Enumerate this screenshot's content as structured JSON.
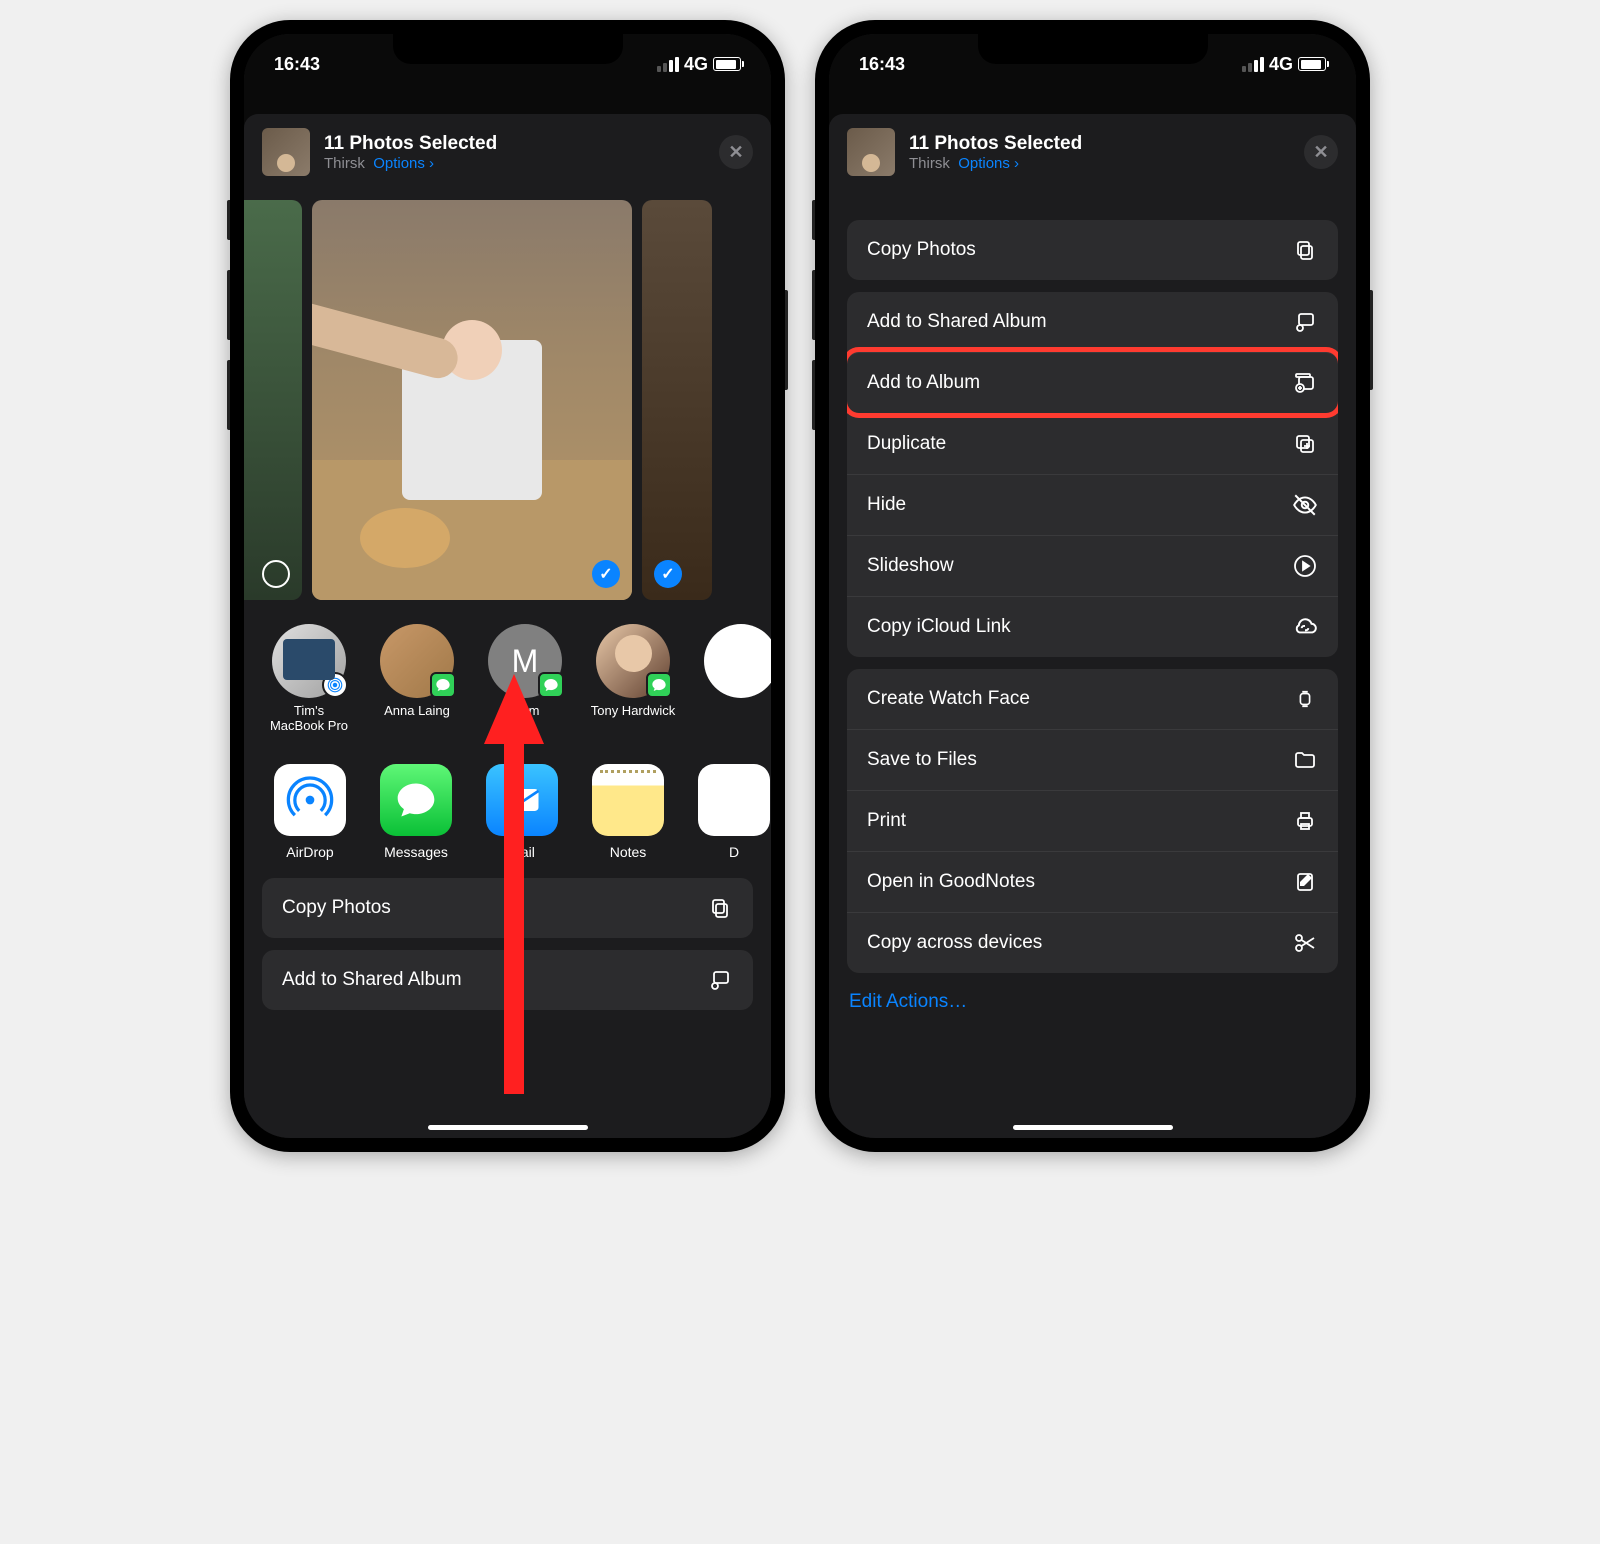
{
  "status": {
    "time": "16:43",
    "network_label": "4G"
  },
  "header": {
    "title": "11 Photos Selected",
    "location": "Thirsk",
    "options_label": "Options"
  },
  "contacts": [
    {
      "name": "Tim's MacBook Pro",
      "badge": "airdrop",
      "avatar": "mac"
    },
    {
      "name": "Anna Laing",
      "badge": "msg",
      "avatar": "person1"
    },
    {
      "name": "Mum",
      "badge": "msg",
      "avatar": "person2",
      "initial": "M"
    },
    {
      "name": "Tony Hardwick",
      "badge": "msg",
      "avatar": "person3"
    }
  ],
  "apps": [
    {
      "name": "AirDrop",
      "kind": "airdrop"
    },
    {
      "name": "Messages",
      "kind": "messages"
    },
    {
      "name": "Mail",
      "kind": "mail"
    },
    {
      "name": "Notes",
      "kind": "notes"
    },
    {
      "name": "D",
      "kind": "partial"
    }
  ],
  "left_actions": {
    "group1": [
      {
        "label": "Copy Photos",
        "icon": "copy"
      }
    ],
    "group2": [
      {
        "label": "Add to Shared Album",
        "icon": "shared-album"
      }
    ]
  },
  "right_actions": {
    "group1": [
      {
        "label": "Copy Photos",
        "icon": "copy"
      }
    ],
    "group2": [
      {
        "label": "Add to Shared Album",
        "icon": "shared-album"
      },
      {
        "label": "Add to Album",
        "icon": "album-add",
        "highlight": true
      },
      {
        "label": "Duplicate",
        "icon": "duplicate"
      },
      {
        "label": "Hide",
        "icon": "eye-slash"
      },
      {
        "label": "Slideshow",
        "icon": "play-circle"
      },
      {
        "label": "Copy iCloud Link",
        "icon": "link-cloud"
      }
    ],
    "group3": [
      {
        "label": "Create Watch Face",
        "icon": "watch"
      },
      {
        "label": "Save to Files",
        "icon": "folder"
      },
      {
        "label": "Print",
        "icon": "printer"
      },
      {
        "label": "Open in GoodNotes",
        "icon": "notebook"
      },
      {
        "label": "Copy across devices",
        "icon": "scissors"
      }
    ]
  },
  "edit_actions_label": "Edit Actions…"
}
